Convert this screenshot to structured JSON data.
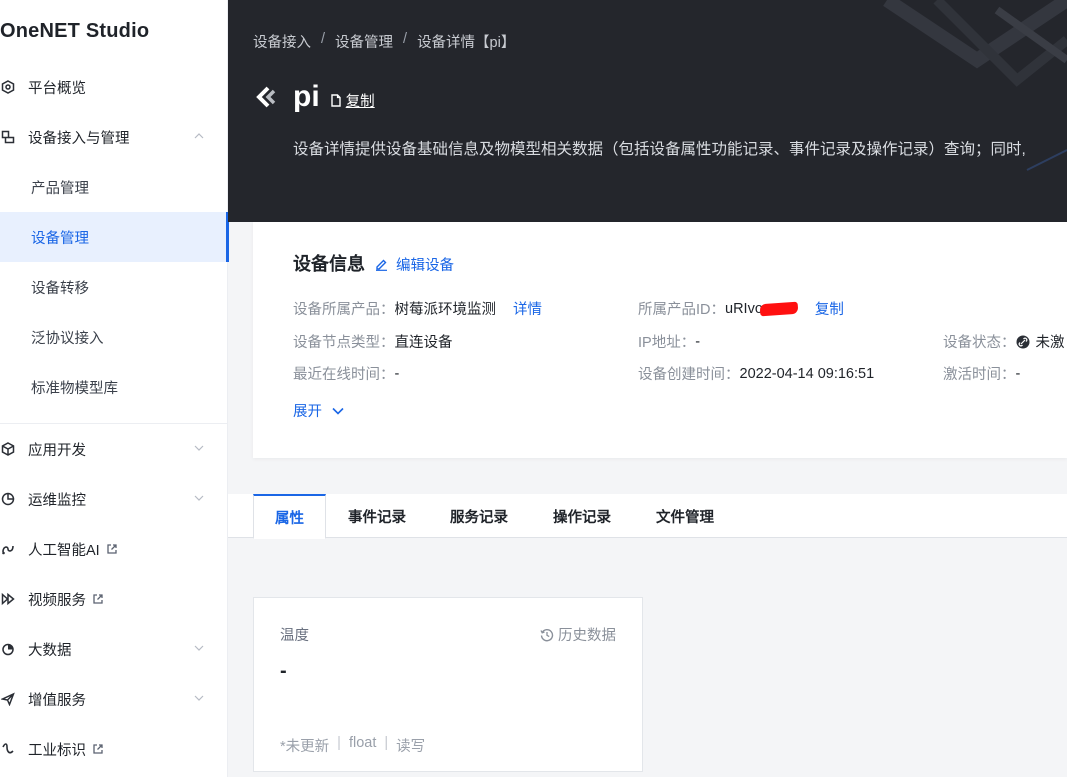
{
  "sidebar": {
    "brand": "OneNET Studio",
    "items": [
      {
        "label": "平台概览"
      },
      {
        "label": "设备接入与管理"
      },
      {
        "label": "应用开发"
      },
      {
        "label": "运维监控"
      },
      {
        "label": "人工智能AI"
      },
      {
        "label": "视频服务"
      },
      {
        "label": "大数据"
      },
      {
        "label": "增值服务"
      },
      {
        "label": "工业标识"
      }
    ],
    "sub_items": [
      {
        "label": "产品管理"
      },
      {
        "label": "设备管理"
      },
      {
        "label": "设备转移"
      },
      {
        "label": "泛协议接入"
      },
      {
        "label": "标准物模型库"
      }
    ]
  },
  "header": {
    "breadcrumb": [
      "设备接入",
      "设备管理",
      "设备详情【pi】"
    ],
    "breadcrumb_sep": "/",
    "title": "pi",
    "copy_label": "复制",
    "description": "设备详情提供设备基础信息及物模型相关数据（包括设备属性功能记录、事件记录及操作记录）查询；同时,"
  },
  "device_info": {
    "title": "设备信息",
    "edit_label": "编辑设备",
    "product_label": "设备所属产品：",
    "product_value": "树莓派环境监测",
    "product_detail_link": "详情",
    "product_id_label": "所属产品ID：",
    "product_id_value": "uRIvo",
    "product_id_copy": "复制",
    "node_type_label": "设备节点类型：",
    "node_type_value": "直连设备",
    "ip_label": "IP地址：",
    "ip_value": "-",
    "status_label": "设备状态：",
    "status_value": "未激",
    "last_online_label": "最近在线时间：",
    "last_online_value": "-",
    "created_label": "设备创建时间：",
    "created_value": "2022-04-14 09:16:51",
    "activated_label": "激活时间：",
    "activated_value": "-",
    "expand_label": "展开"
  },
  "tabs": [
    {
      "label": "属性"
    },
    {
      "label": "事件记录"
    },
    {
      "label": "服务记录"
    },
    {
      "label": "操作记录"
    },
    {
      "label": "文件管理"
    }
  ],
  "property_card": {
    "name": "温度",
    "history_label": "历史数据",
    "value": "-",
    "update_status": "*未更新",
    "data_type": "float",
    "access": "读写",
    "sep": "|"
  },
  "colors": {
    "accent": "#1a66e6",
    "banner_bg": "#24262c",
    "active_bg": "#e8f0fe"
  }
}
